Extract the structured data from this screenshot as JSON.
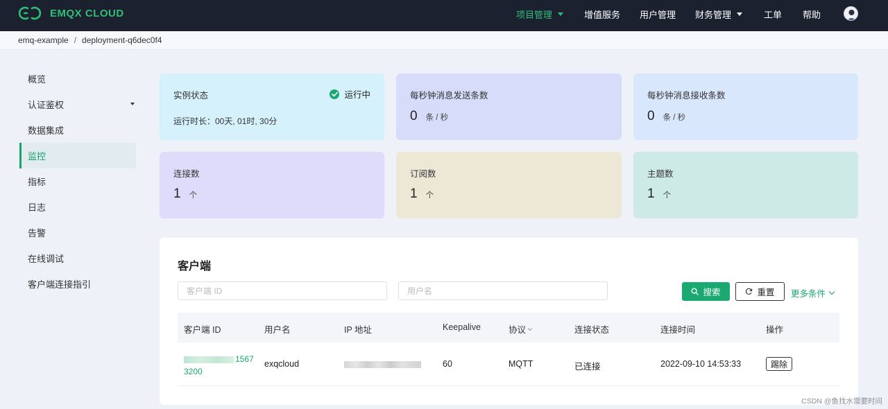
{
  "app": {
    "logo_text": "EMQX CLOUD",
    "brand_color": "#2fbf77"
  },
  "nav": {
    "items": [
      {
        "label": "项目管理",
        "active": true,
        "dropdown": true
      },
      {
        "label": "增值服务",
        "active": false,
        "dropdown": false
      },
      {
        "label": "用户管理",
        "active": false,
        "dropdown": false
      },
      {
        "label": "财务管理",
        "active": false,
        "dropdown": true
      },
      {
        "label": "工单",
        "active": false,
        "dropdown": false
      },
      {
        "label": "帮助",
        "active": false,
        "dropdown": false
      }
    ],
    "avatar_icon": "user-avatar-icon"
  },
  "breadcrumb": {
    "items": [
      "emq-example",
      "deployment-q6dec0f4"
    ],
    "separator": "/"
  },
  "sidebar": {
    "items": [
      {
        "label": "概览",
        "active": false
      },
      {
        "label": "认证鉴权",
        "active": false,
        "dropdown": true
      },
      {
        "label": "数据集成",
        "active": false
      },
      {
        "label": "监控",
        "active": true
      },
      {
        "label": "指标",
        "active": false
      },
      {
        "label": "日志",
        "active": false
      },
      {
        "label": "告警",
        "active": false
      },
      {
        "label": "在线调试",
        "active": false
      },
      {
        "label": "客户端连接指引",
        "active": false
      }
    ]
  },
  "stats": {
    "instance": {
      "title": "实例状态",
      "status": "运行中",
      "runtime": "运行时长：00天, 01时, 30分",
      "color": "#d5f1fb"
    },
    "send_rate": {
      "title": "每秒钟消息发送条数",
      "value": "0",
      "unit": "条 / 秒",
      "color": "#d6dcfa"
    },
    "recv_rate": {
      "title": "每秒钟消息接收条数",
      "value": "0",
      "unit": "条 / 秒",
      "color": "#d9e7fc"
    },
    "connections": {
      "title": "连接数",
      "value": "1",
      "unit": "个",
      "color": "#dedcfa"
    },
    "subscriptions": {
      "title": "订阅数",
      "value": "1",
      "unit": "个",
      "color": "#ede7d6"
    },
    "topics": {
      "title": "主题数",
      "value": "1",
      "unit": "个",
      "color": "#cdeae6"
    }
  },
  "clients": {
    "title": "客户端",
    "client_id_placeholder": "客户端 ID",
    "username_placeholder": "用户名",
    "search_label": "搜索",
    "reset_label": "重置",
    "more_label": "更多条件",
    "columns": [
      "客户端 ID",
      "用户名",
      "IP 地址",
      "Keepalive",
      "协议",
      "连接状态",
      "连接时间",
      "操作"
    ],
    "rows": [
      {
        "client_id_tail": "1567",
        "client_id_line2": "3200",
        "username": "exqcloud",
        "keepalive": "60",
        "protocol": "MQTT",
        "status": "已连接",
        "connected_at": "2022-09-10 14:53:33",
        "action": "踢除"
      }
    ]
  },
  "watermark": "CSDN @鱼找水需要时间"
}
